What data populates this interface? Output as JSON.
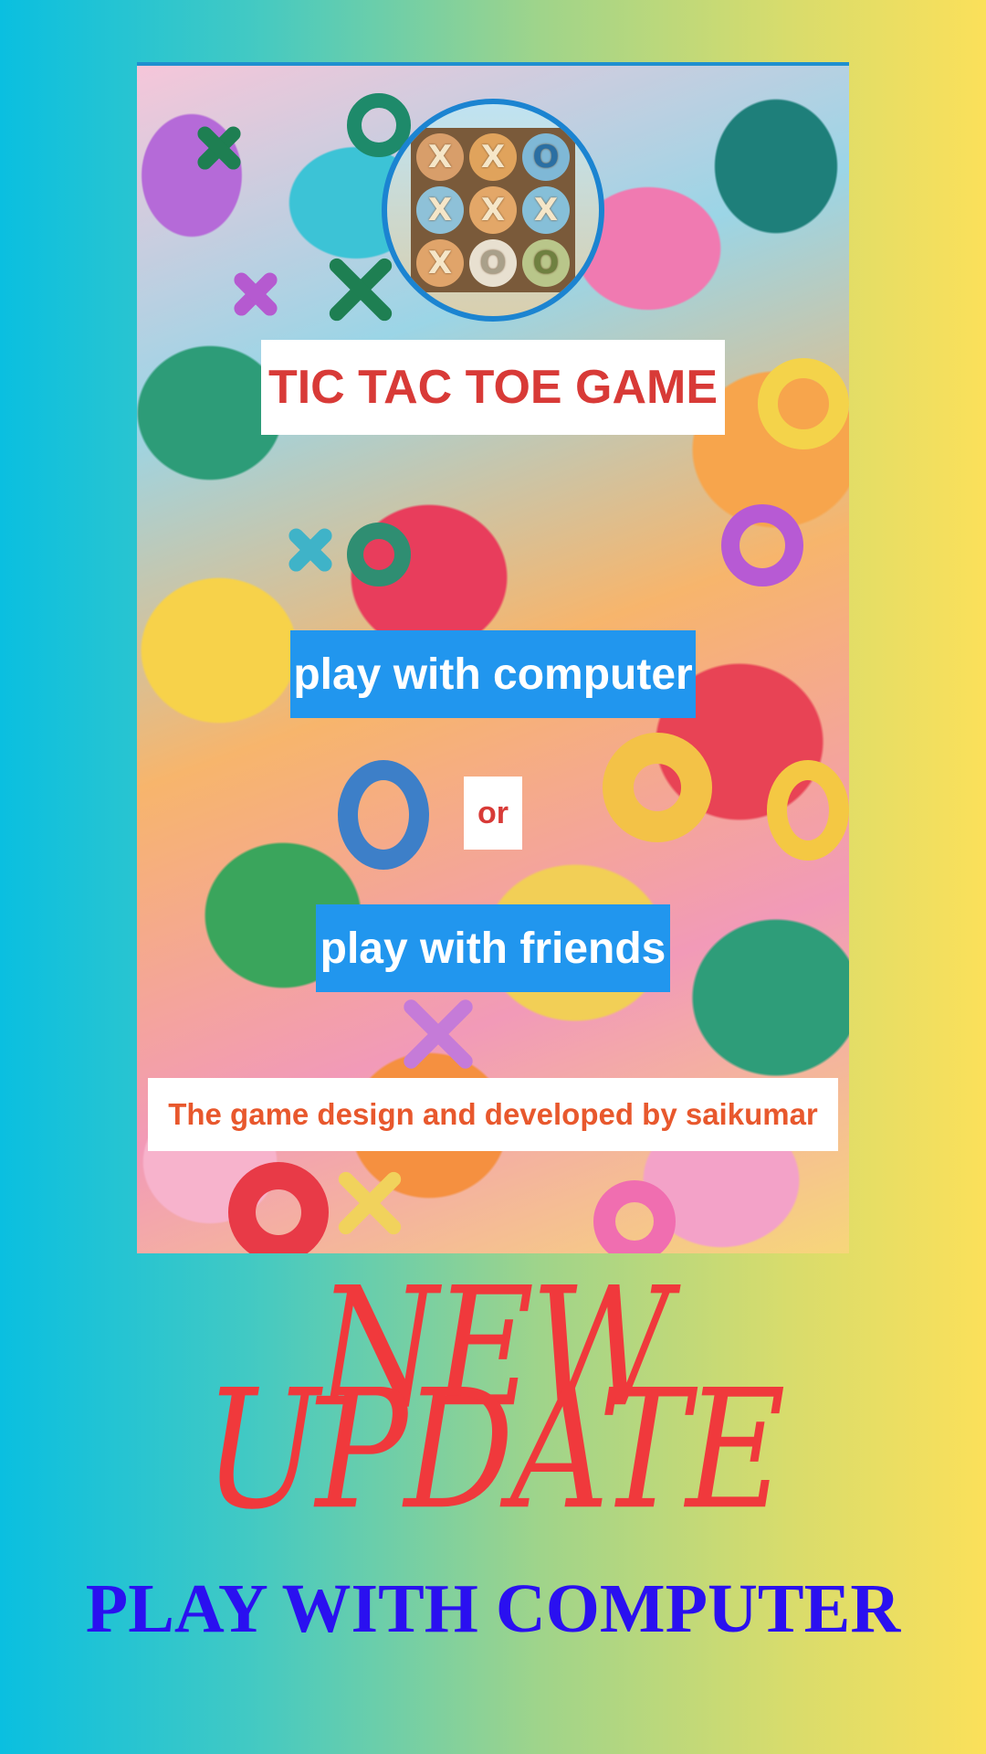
{
  "game": {
    "title": "TIC TAC TOE GAME",
    "buttons": {
      "play_computer": "play with computer",
      "or": "or",
      "play_friends": "play with friends"
    },
    "credit": "The game design and developed by saikumar",
    "logo_cells": [
      "X",
      "X",
      "O",
      "X",
      "X",
      "X",
      "X",
      "O",
      "O"
    ]
  },
  "promo": {
    "line1": "NEW",
    "line2": "UPDATE",
    "subtitle": "PLAY WITH COMPUTER"
  },
  "colors": {
    "title_red": "#d83a37",
    "button_blue": "#2196ee",
    "credit_orange": "#e8582d",
    "promo_red": "#f0393c",
    "promo_blue": "#2a10f0"
  }
}
